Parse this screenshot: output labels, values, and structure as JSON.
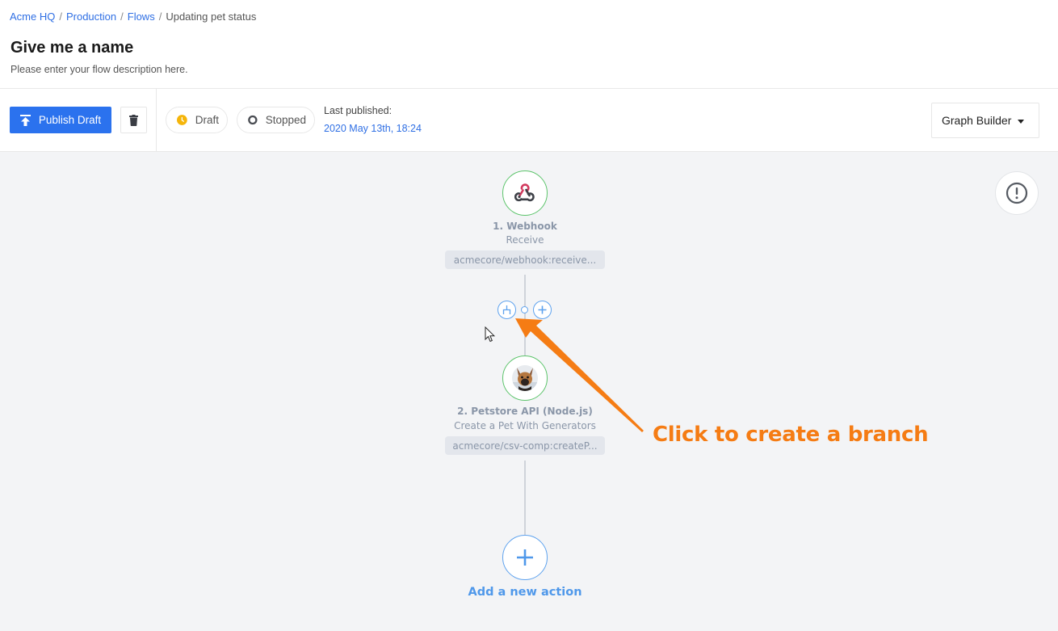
{
  "breadcrumb": {
    "items": [
      "Acme HQ",
      "Production",
      "Flows"
    ],
    "current": "Updating pet status",
    "separator": "/"
  },
  "flow": {
    "title": "Give me a name",
    "description": "Please enter your flow description here."
  },
  "toolbar": {
    "publish_label": "Publish Draft",
    "publish_icon": "upload-icon",
    "delete_icon": "trash-icon",
    "status_draft": "Draft",
    "status_stopped": "Stopped",
    "last_published_label": "Last published:",
    "last_published_date": "2020 May 13th, 18:24",
    "view_mode": "Graph Builder"
  },
  "canvas": {
    "alert_icon": "exclamation-circle-icon",
    "nodes": [
      {
        "title": "1. Webhook",
        "subtitle": "Receive",
        "chip": "acmecore/webhook:receive...",
        "icon": "webhook-icon"
      },
      {
        "title": "2. Petstore API (Node.js)",
        "subtitle": "Create a Pet With Generators",
        "chip": "acmecore/csv-comp:createP...",
        "icon": "dog-avatar-icon"
      }
    ],
    "add_action_label": "Add a new action",
    "annotation": "Click to create a branch"
  },
  "colors": {
    "primary": "#2b72ee",
    "link": "#2f6fe4",
    "node_border": "#5cc46b",
    "accent_blue": "#5ea2ee",
    "annotation": "#f57c14",
    "draft_status": "#f5b50a",
    "canvas_bg": "#f3f4f6"
  }
}
